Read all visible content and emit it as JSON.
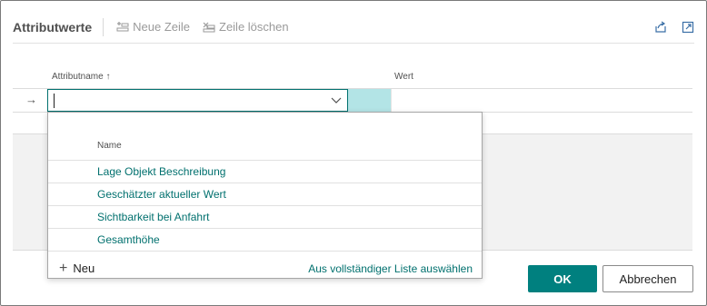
{
  "toolbar": {
    "title": "Attributwerte",
    "new_row": "Neue Zeile",
    "delete_row": "Zeile löschen"
  },
  "grid": {
    "columns": [
      "Attributname ↑",
      "Wert"
    ]
  },
  "dropdown": {
    "header": "Name",
    "items": [
      "Lage Objekt Beschreibung",
      "Geschätzter aktueller Wert",
      "Sichtbarkeit bei Anfahrt",
      "Gesamthöhe"
    ],
    "new_label": "Neu",
    "full_list_label": "Aus vollständiger Liste auswählen"
  },
  "buttons": {
    "ok": "OK",
    "cancel": "Abbrechen"
  },
  "colors": {
    "accent": "#00807f",
    "link": "#00706e",
    "selected_cell": "#b3e4e6"
  }
}
